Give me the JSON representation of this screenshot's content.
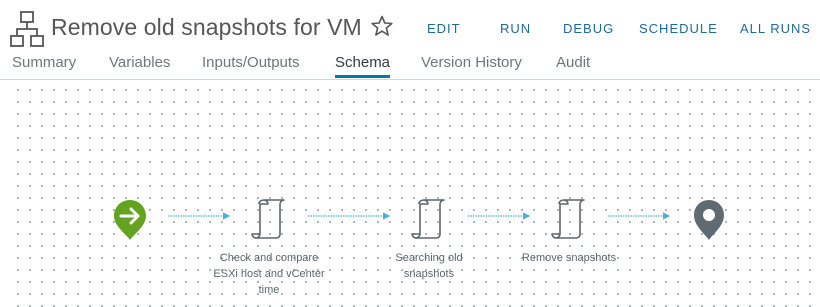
{
  "header": {
    "icon": "workflow-icon",
    "title": "Remove old snapshots for VM",
    "favorite_icon": "star-icon",
    "actions": [
      "EDIT",
      "RUN",
      "DEBUG",
      "SCHEDULE",
      "ALL RUNS"
    ]
  },
  "tabs": {
    "items": [
      "Summary",
      "Variables",
      "Inputs/Outputs",
      "Schema",
      "Version History",
      "Audit"
    ],
    "active": "Schema"
  },
  "schema": {
    "nodes": [
      {
        "type": "start",
        "icon": "start-arrow-icon",
        "label": ""
      },
      {
        "type": "scriptable-task",
        "icon": "script-scroll-icon",
        "label": "Check and compare\nESXi host and vCenter\ntime"
      },
      {
        "type": "scriptable-task",
        "icon": "script-scroll-icon",
        "label": "Searching old\nsnapshots"
      },
      {
        "type": "scriptable-task",
        "icon": "script-scroll-icon",
        "label": "Remove snapshots"
      },
      {
        "type": "end",
        "icon": "end-pin-icon",
        "label": ""
      }
    ]
  },
  "colors": {
    "accent": "#1d6b97",
    "tab_active": "#0079ad",
    "start_node": "#62a420",
    "end_node": "#5f6b73",
    "connector": "#49afd9",
    "task_icon": "#5c666c"
  }
}
